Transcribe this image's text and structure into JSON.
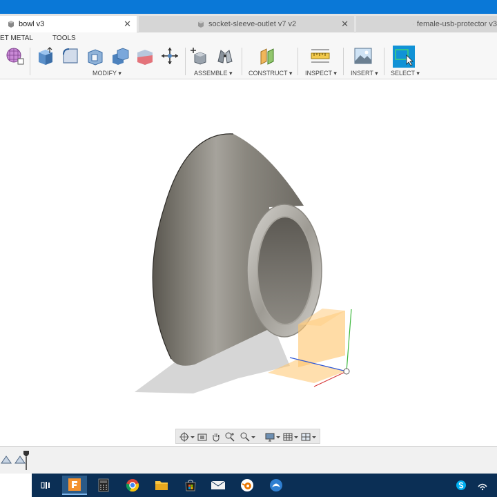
{
  "tabs": [
    {
      "label": "bowl v3",
      "active": true
    },
    {
      "label": "socket-sleeve-outlet v7 v2",
      "active": false
    },
    {
      "label": "female-usb-protector v3",
      "active": false
    }
  ],
  "toolbar": {
    "workspace_tabs": [
      "ET METAL",
      "TOOLS"
    ],
    "groups": [
      "MODIFY ▾",
      "ASSEMBLE ▾",
      "CONSTRUCT ▾",
      "INSPECT ▾",
      "INSERT ▾",
      "SELECT ▾"
    ]
  },
  "colors": {
    "title_bar": "#0a78d7",
    "taskbar": "#0b2f55",
    "select_accent": "#1192d6",
    "origin_plane": "#ffc56b"
  },
  "icons": {
    "taskbar": [
      "task-view-icon",
      "fusion360-icon",
      "calculator-icon",
      "chrome-icon",
      "file-explorer-icon",
      "store-icon",
      "mail-icon",
      "blender-icon",
      "orca-icon"
    ],
    "tray": [
      "skype-icon",
      "network-icon"
    ]
  }
}
